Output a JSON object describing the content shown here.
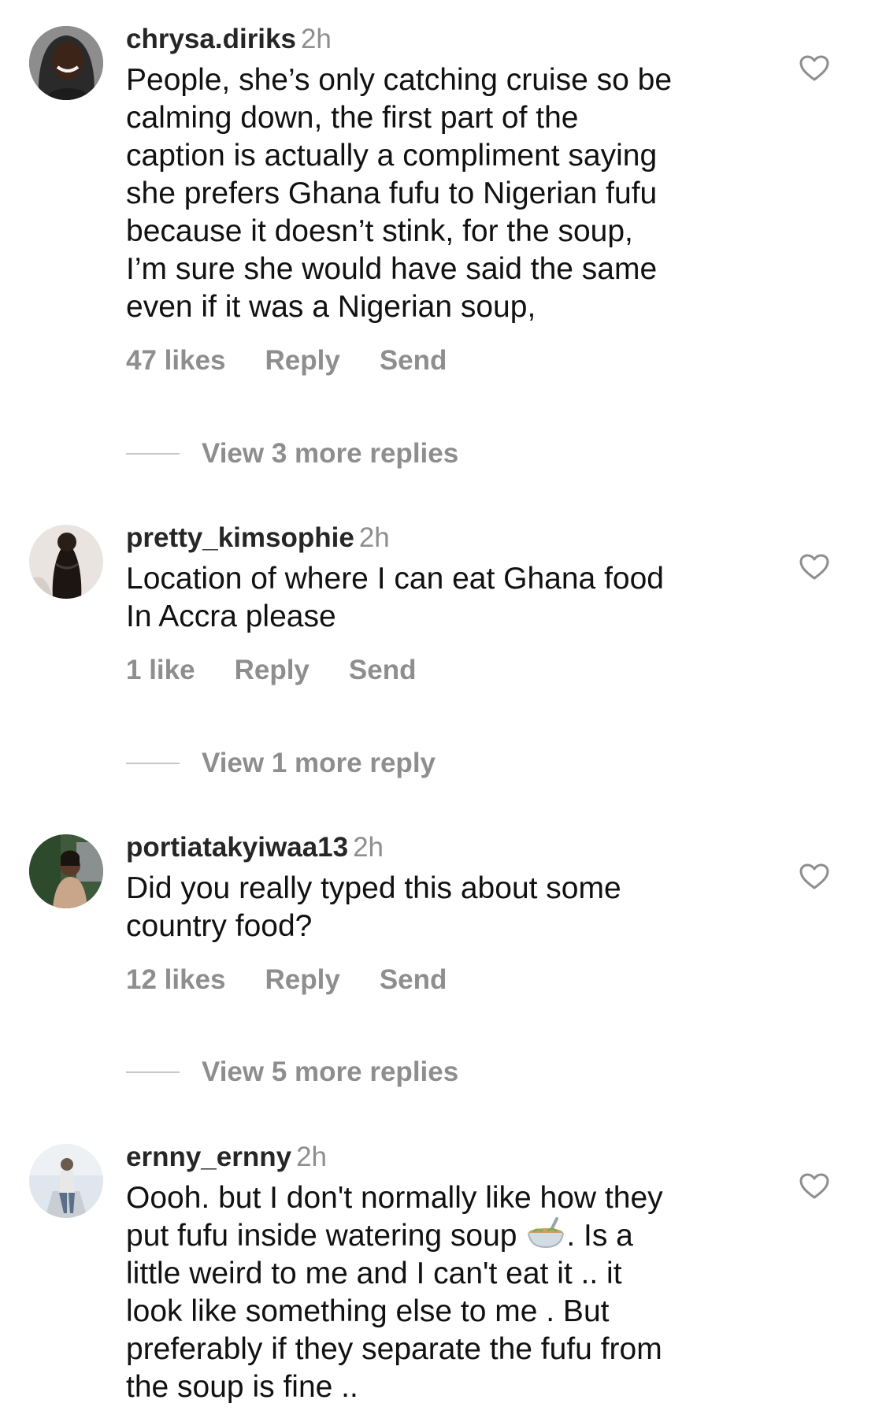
{
  "comments": [
    {
      "username": "chrysa.diriks",
      "time": "2h",
      "lines": [
        "People, she’s only catching cruise so be",
        "calming down, the first part of the",
        "caption is actually a compliment saying",
        "she prefers Ghana fufu to Nigerian fufu",
        "because it doesn’t stink, for the soup,",
        "I’m sure she would have said the same",
        "even if it was a Nigerian soup,"
      ],
      "likes": "47 likes",
      "reply": "Reply",
      "send": "Send",
      "view_more": "View 3 more replies",
      "avatar_icon": "profile-photo"
    },
    {
      "username": "pretty_kimsophie",
      "time": "2h",
      "lines": [
        "Location of where I can eat Ghana food",
        "In Accra please"
      ],
      "likes": "1 like",
      "reply": "Reply",
      "send": "Send",
      "view_more": "View 1 more reply",
      "avatar_icon": "profile-photo"
    },
    {
      "username": "portiatakyiwaa13",
      "time": "2h",
      "lines": [
        "Did you really typed this about some",
        "country food?"
      ],
      "likes": "12 likes",
      "reply": "Reply",
      "send": "Send",
      "view_more": "View 5 more replies",
      "avatar_icon": "profile-photo"
    },
    {
      "username": "ernny_ernny",
      "time": "2h",
      "lines": [
        "Oooh. but I don't normally like how they",
        "put fufu inside watering soup",
        ". Is a",
        "little weird to me and I can't eat it .. it",
        "look like something else to me . But",
        "preferably if they separate the fufu from",
        "the soup is fine .."
      ],
      "emoji": "bowl-with-spoon-emoji",
      "avatar_icon": "profile-photo"
    }
  ],
  "icons": {
    "like": "heart-outline-icon"
  },
  "colors": {
    "text": "#111111",
    "secondary": "#8e8e8e",
    "divider": "#c7c7c7",
    "background": "#ffffff"
  }
}
